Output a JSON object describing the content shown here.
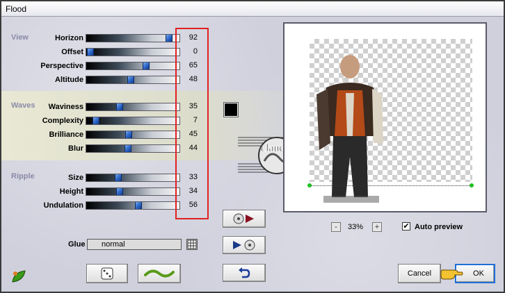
{
  "window": {
    "title": "Flood"
  },
  "groups": {
    "view": "View",
    "waves": "Waves",
    "ripple": "Ripple"
  },
  "params": [
    {
      "label": "Horizon",
      "value": "92"
    },
    {
      "label": "Offset",
      "value": "0"
    },
    {
      "label": "Perspective",
      "value": "65"
    },
    {
      "label": "Altitude",
      "value": "48"
    },
    {
      "label": "Waviness",
      "value": "35"
    },
    {
      "label": "Complexity",
      "value": "7"
    },
    {
      "label": "Brilliance",
      "value": "45"
    },
    {
      "label": "Blur",
      "value": "44"
    },
    {
      "label": "Size",
      "value": "33"
    },
    {
      "label": "Height",
      "value": "34"
    },
    {
      "label": "Undulation",
      "value": "56"
    }
  ],
  "swatch_color": "#000000",
  "watermark_text": "claudia",
  "zoom": {
    "value": "33%",
    "minus": "-",
    "plus": "+"
  },
  "auto_preview": {
    "label": "Auto preview",
    "checked": "✔"
  },
  "glue": {
    "label": "Glue",
    "value": "normal"
  },
  "buttons": {
    "cancel": "Cancel",
    "ok": "OK"
  },
  "colors": {
    "accent": "#1e6fd6",
    "highlight": "#e02020",
    "label_group": "#8a8aa8"
  }
}
